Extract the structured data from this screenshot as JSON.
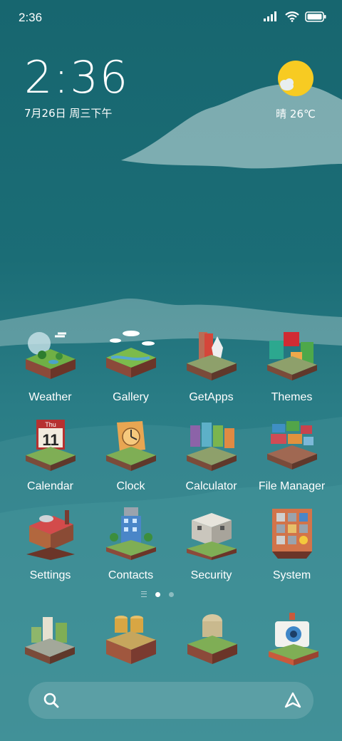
{
  "status_bar": {
    "time": "2:36",
    "icons": [
      "signal-icon",
      "wifi-icon",
      "battery-icon"
    ]
  },
  "clock_widget": {
    "time": "2:36",
    "date": "7月26日 周三下午"
  },
  "weather_widget": {
    "condition_icon": "sun-cloud-icon",
    "text": "晴 26℃"
  },
  "apps": [
    {
      "name": "weather",
      "label": "Weather",
      "icon": "weather-icon"
    },
    {
      "name": "gallery",
      "label": "Gallery",
      "icon": "gallery-icon"
    },
    {
      "name": "getapps",
      "label": "GetApps",
      "icon": "getapps-icon"
    },
    {
      "name": "themes",
      "label": "Themes",
      "icon": "themes-icon"
    },
    {
      "name": "calendar",
      "label": "Calendar",
      "icon": "calendar-icon"
    },
    {
      "name": "clock",
      "label": "Clock",
      "icon": "clock-icon"
    },
    {
      "name": "calculator",
      "label": "Calculator",
      "icon": "calculator-icon"
    },
    {
      "name": "file-manager",
      "label": "File Manager",
      "icon": "folder-icon"
    },
    {
      "name": "settings",
      "label": "Settings",
      "icon": "gear-icon"
    },
    {
      "name": "contacts",
      "label": "Contacts",
      "icon": "contacts-icon"
    },
    {
      "name": "security",
      "label": "Security",
      "icon": "shield-icon"
    },
    {
      "name": "system",
      "label": "System",
      "icon": "system-icon"
    }
  ],
  "calendar_icon": {
    "weekday": "Thu",
    "day": "11"
  },
  "page_indicator": {
    "pages": 2,
    "current": 1
  },
  "dock": [
    {
      "name": "phone",
      "icon": "phone-icon"
    },
    {
      "name": "messages",
      "icon": "messages-icon"
    },
    {
      "name": "browser",
      "icon": "browser-icon"
    },
    {
      "name": "camera",
      "icon": "camera-icon"
    }
  ],
  "search_bar": {
    "search_icon": "search-icon",
    "assistant_icon": "assistant-icon"
  },
  "colors": {
    "sky": "#1b6d76",
    "sun": "#f7cb22",
    "cloud": "#b7d3d3"
  }
}
